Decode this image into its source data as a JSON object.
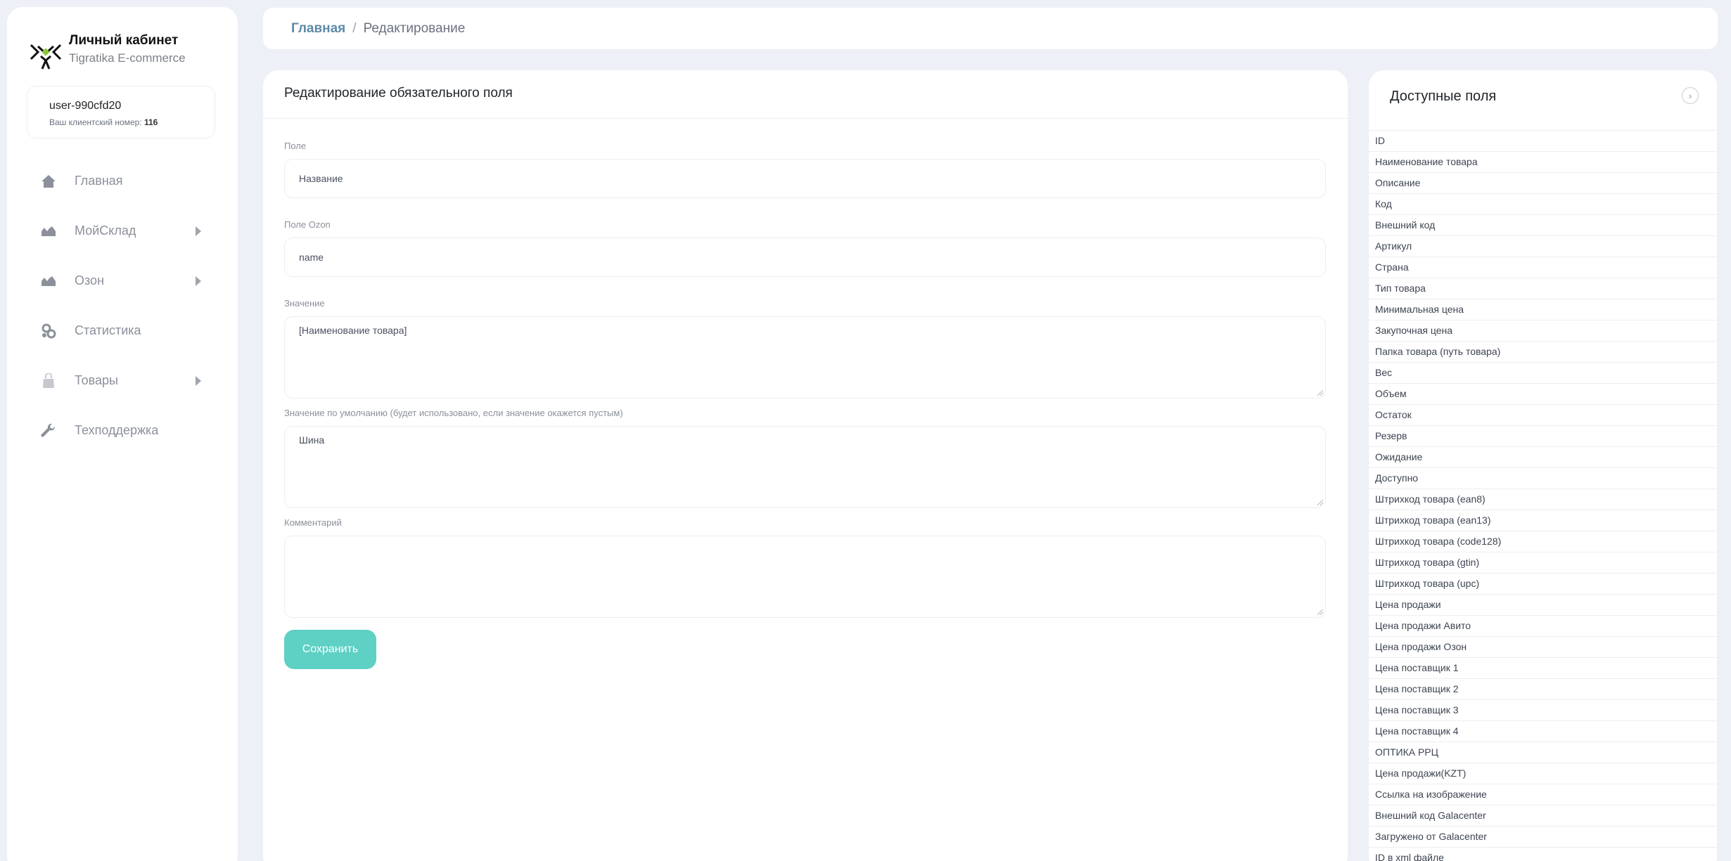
{
  "sidebar": {
    "brand_title": "Личный кабинет",
    "brand_subtitle": "Tigratika E-commerce",
    "user_name": "user-990cfd20",
    "client_label": "Ваш клиентский номер:",
    "client_number": "116",
    "nav": [
      {
        "label": "Главная",
        "icon": "home-icon",
        "has_arrow": false
      },
      {
        "label": "МойСклад",
        "icon": "mountain-icon",
        "has_arrow": true
      },
      {
        "label": "Озон",
        "icon": "mountain-icon",
        "has_arrow": true
      },
      {
        "label": "Статистика",
        "icon": "gears-icon",
        "has_arrow": false
      },
      {
        "label": "Товары",
        "icon": "bag-icon",
        "has_arrow": true
      },
      {
        "label": "Техподдержка",
        "icon": "wrench-icon",
        "has_arrow": false
      }
    ]
  },
  "breadcrumb": {
    "home": "Главная",
    "separator": "/",
    "current": "Редактирование"
  },
  "form": {
    "title": "Редактирование обязательного поля",
    "field_label": "Поле",
    "field_value": "Название",
    "ozon_label": "Поле Ozon",
    "ozon_value": "name",
    "value_label": "Значение",
    "value_value": "[Наименование товара]",
    "default_label": "Значение по умолчанию (будет использовано, если значение окажется пустым)",
    "default_value": "Шина",
    "comment_label": "Комментарий",
    "comment_value": "",
    "save_label": "Сохранить"
  },
  "available_fields": {
    "title": "Доступные поля",
    "collapse_icon": "chevron-right-icon",
    "items": [
      "ID",
      "Наименование товара",
      "Описание",
      "Код",
      "Внешний код",
      "Артикул",
      "Страна",
      "Тип товара",
      "Минимальная цена",
      "Закупочная цена",
      "Папка товара (путь товара)",
      "Вес",
      "Объем",
      "Остаток",
      "Резерв",
      "Ожидание",
      "Доступно",
      "Штрихкод товара (ean8)",
      "Штрихкод товара (ean13)",
      "Штрихкод товара (code128)",
      "Штрихкод товара (gtin)",
      "Штрихкод товара (upc)",
      "Цена продажи",
      "Цена продажи Авито",
      "Цена продажи Озон",
      "Цена поставщик 1",
      "Цена поставщик 2",
      "Цена поставщик 3",
      "Цена поставщик 4",
      "ОПТИКА РРЦ",
      "Цена продажи(KZT)",
      "Ссылка на изображение",
      "Внешний код Galacenter",
      "Загружено от Galacenter",
      "ID в xml файле"
    ]
  },
  "colors": {
    "accent": "#5ed0c4",
    "link": "#5d8aa8",
    "background": "#eef0f7",
    "logo_green": "#8cc63f"
  }
}
